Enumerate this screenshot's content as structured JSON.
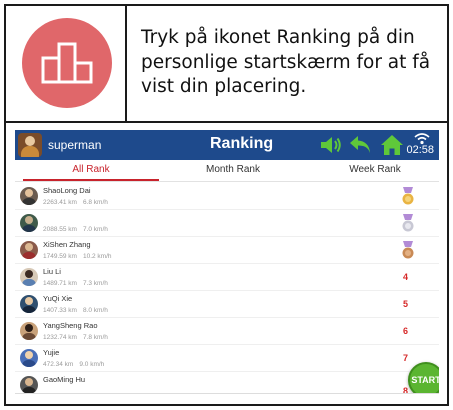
{
  "instruction": {
    "text": "Tryk på ikonet Ranking på din personlige startskærm for at få vist din placering.",
    "icon": "ranking-podium-icon",
    "icon_bg_color": "#e0676a"
  },
  "screen": {
    "topbar": {
      "username": "superman",
      "title": "Ranking",
      "time": "02:58",
      "bg_color": "#1e4a8c",
      "icons": [
        "volume-icon",
        "back-arrow-icon",
        "home-icon",
        "wifi-icon"
      ]
    },
    "tabs": [
      {
        "label": "All Rank",
        "active": true
      },
      {
        "label": "Month Rank",
        "active": false
      },
      {
        "label": "Week Rank",
        "active": false
      }
    ],
    "ranking": [
      {
        "name": "ShaoLong Dai",
        "distance": "2263.41 km",
        "speed": "6.8 km/h",
        "rank": "1",
        "badge": "gold-medal-icon"
      },
      {
        "name": "",
        "distance": "2088.55 km",
        "speed": "7.0 km/h",
        "rank": "2",
        "badge": "silver-medal-icon"
      },
      {
        "name": "XiShen Zhang",
        "distance": "1749.59 km",
        "speed": "10.2 km/h",
        "rank": "3",
        "badge": "bronze-medal-icon"
      },
      {
        "name": "Liu Li",
        "distance": "1489.71 km",
        "speed": "7.3 km/h",
        "rank": "4"
      },
      {
        "name": "YuQi Xie",
        "distance": "1407.33 km",
        "speed": "8.0 km/h",
        "rank": "5"
      },
      {
        "name": "YangSheng Rao",
        "distance": "1232.74 km",
        "speed": "7.8 km/h",
        "rank": "6"
      },
      {
        "name": "Yujie",
        "distance": "472.34 km",
        "speed": "9.0 km/h",
        "rank": "7"
      },
      {
        "name": "GaoMing Hu",
        "distance": "",
        "speed": "",
        "rank": "8"
      }
    ],
    "start_button": {
      "label": "START",
      "color": "#5bb531"
    },
    "accent_color": "#c8232c"
  }
}
